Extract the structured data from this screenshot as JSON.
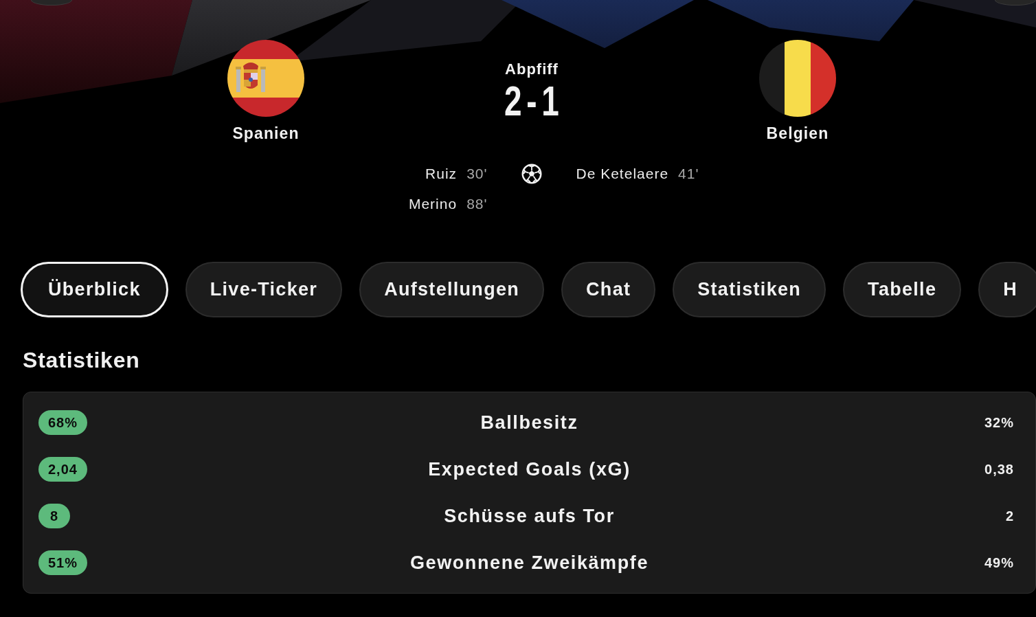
{
  "match": {
    "status": "Abpfiff",
    "score": "2 - 1",
    "home": {
      "name": "Spanien"
    },
    "away": {
      "name": "Belgien"
    },
    "goals": {
      "home": [
        {
          "player": "Ruiz",
          "minute": "30'"
        },
        {
          "player": "Merino",
          "minute": "88'"
        }
      ],
      "away": [
        {
          "player": "De Ketelaere",
          "minute": "41'"
        }
      ]
    }
  },
  "tabs": [
    {
      "label": "Überblick",
      "selected": true
    },
    {
      "label": "Live-Ticker",
      "selected": false
    },
    {
      "label": "Aufstellungen",
      "selected": false
    },
    {
      "label": "Chat",
      "selected": false
    },
    {
      "label": "Statistiken",
      "selected": false
    },
    {
      "label": "Tabelle",
      "selected": false
    },
    {
      "label": "H",
      "selected": false
    }
  ],
  "stats": {
    "title": "Statistiken",
    "rows": [
      {
        "label": "Ballbesitz",
        "home": {
          "value": "68%",
          "highlighted": true
        },
        "away": {
          "value": "32%",
          "highlighted": false
        }
      },
      {
        "label": "Expected Goals (xG)",
        "home": {
          "value": "2,04",
          "highlighted": true
        },
        "away": {
          "value": "0,38",
          "highlighted": false
        }
      },
      {
        "label": "Schüsse aufs Tor",
        "home": {
          "value": "8",
          "highlighted": true
        },
        "away": {
          "value": "2",
          "highlighted": false
        }
      },
      {
        "label": "Gewonnene Zweikämpfe",
        "home": {
          "value": "51%",
          "highlighted": true
        },
        "away": {
          "value": "49%",
          "highlighted": false
        }
      }
    ]
  }
}
